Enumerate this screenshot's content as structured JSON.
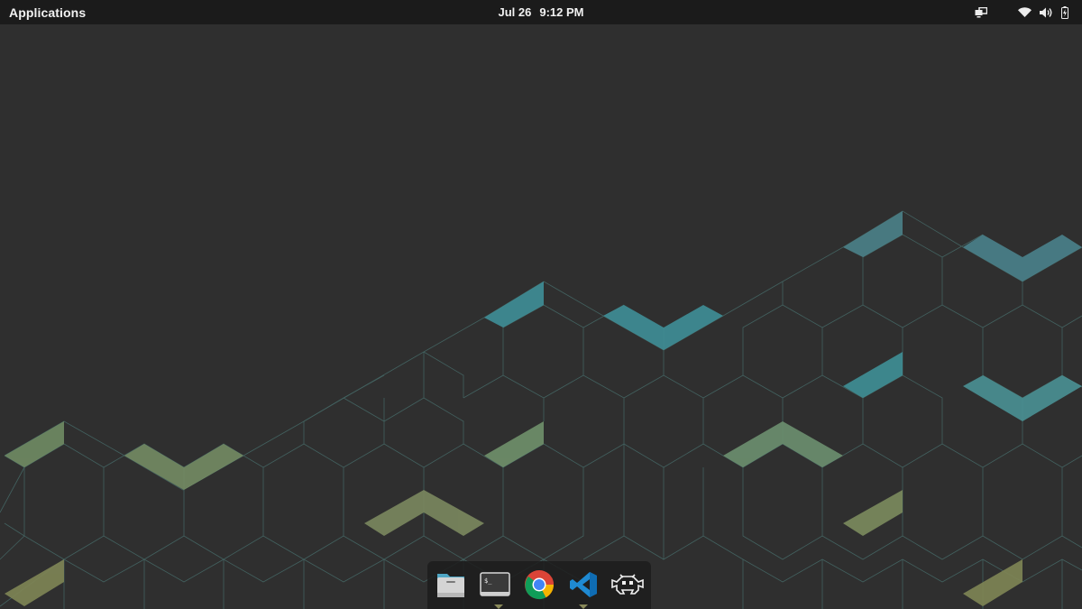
{
  "topbar": {
    "applications_label": "Applications",
    "date": "Jul 26",
    "time": "9:12 PM",
    "tray_icons": [
      "display-switch-icon",
      "wifi-icon",
      "volume-icon",
      "battery-charging-icon"
    ]
  },
  "dock": {
    "apps": [
      {
        "name": "Files",
        "icon": "folder-icon",
        "running": false
      },
      {
        "name": "Terminal",
        "icon": "terminal-icon",
        "running": false
      },
      {
        "name": "Google Chrome",
        "icon": "chrome-icon",
        "running": true
      },
      {
        "name": "Visual Studio Code",
        "icon": "vscode-icon",
        "running": false
      },
      {
        "name": "Game",
        "icon": "space-invader-icon",
        "running": false
      }
    ]
  },
  "colors": {
    "topbar": "#1b1b1b",
    "desktop": "#2f2f2f",
    "accent_teal": "#3d8c94",
    "accent_olive": "#7a8a60",
    "line": "#4a6d6a"
  }
}
